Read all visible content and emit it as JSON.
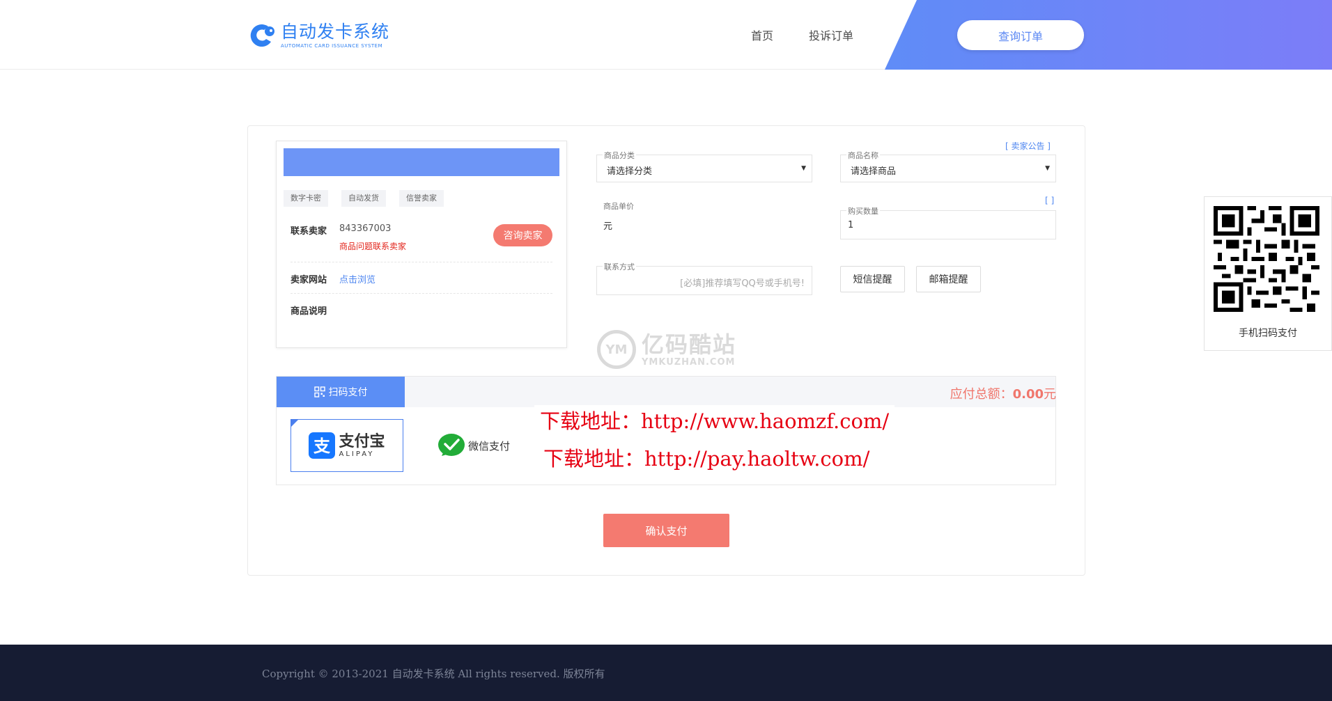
{
  "header": {
    "logo_title": "自动发卡系统",
    "logo_subtitle": "AUTOMATIC CARD ISSUANCE SYSTEM",
    "nav": [
      {
        "label": "首页"
      },
      {
        "label": "投诉订单"
      }
    ],
    "query_button": "查询订单",
    "accent_gradient": [
      "#5f8cf7",
      "#7c7df8"
    ]
  },
  "seller": {
    "tags": [
      "数字卡密",
      "自动发货",
      "信誉卖家"
    ],
    "contact_label": "联系卖家",
    "contact_value": "843367003",
    "contact_note": "商品问题联系卖家",
    "consult_button": "咨询卖家",
    "site_label": "卖家网站",
    "site_link": "点击浏览",
    "desc_label": "商品说明"
  },
  "form": {
    "seller_notice": "[ 卖家公告 ]",
    "category": {
      "label": "商品分类",
      "value": "请选择分类"
    },
    "product": {
      "label": "商品名称",
      "value": "请选择商品"
    },
    "stock_bracket": "[ ]",
    "price": {
      "label": "商品单价",
      "value": "元"
    },
    "quantity": {
      "label": "购买数量",
      "value": "1"
    },
    "contact": {
      "label": "联系方式",
      "placeholder": "[必填]推荐填写QQ号或手机号!"
    },
    "sms_button": "短信提醒",
    "email_button": "邮箱提醒"
  },
  "watermark": {
    "cn": "亿码酷站",
    "en": "YMKUZHAN.COM",
    "mark": "YM"
  },
  "payment": {
    "tab_label": "扫码支付",
    "total_label": "应付总额：",
    "total_value": "0.00",
    "total_unit": "元",
    "alipay_cn": "支付宝",
    "alipay_en": "ALIPAY",
    "wechat": "微信支付",
    "download_lines": [
      "下载地址：http://www.haomzf.com/",
      "下载地址：http://pay.haoltw.com/"
    ],
    "confirm_button": "确认支付"
  },
  "qr": {
    "caption": "手机扫码支付"
  },
  "footer": {
    "copyright": "Copyright © 2013-2021 自动发卡系统 All rights reserved. 版权所有"
  }
}
